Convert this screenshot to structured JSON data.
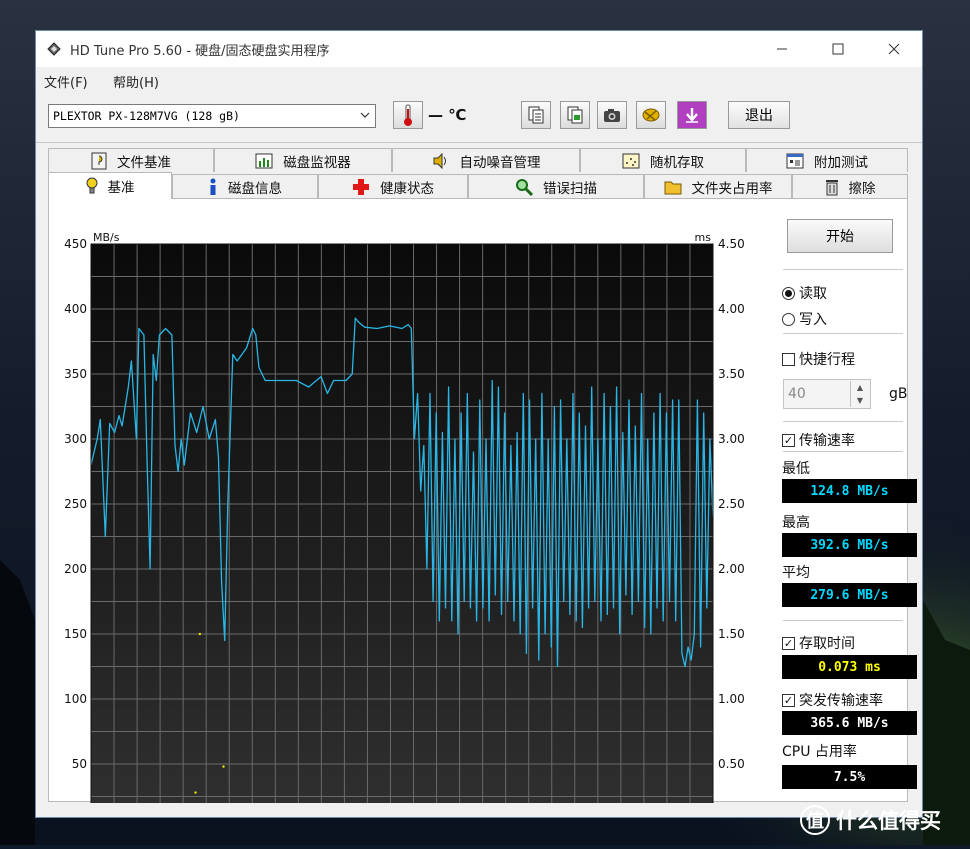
{
  "window": {
    "title": "HD Tune Pro 5.60 - 硬盘/固态硬盘实用程序",
    "controls": [
      "minimize",
      "maximize",
      "close"
    ]
  },
  "menu": {
    "items": [
      "文件(F)",
      "帮助(H)"
    ]
  },
  "toolbar": {
    "drive": "PLEXTOR PX-128M7VG (128 gB)",
    "temperature": "— ℃",
    "exit_label": "退出",
    "icons": [
      "thermometer-icon",
      "copy-text-icon",
      "copy-image-icon",
      "camera-icon",
      "options-icon",
      "download-icon"
    ]
  },
  "tabs": {
    "row1": [
      {
        "label": "文件基准",
        "icon": "file-benchmark-icon"
      },
      {
        "label": "磁盘监视器",
        "icon": "disk-monitor-icon"
      },
      {
        "label": "自动噪音管理",
        "icon": "speaker-icon"
      },
      {
        "label": "随机存取",
        "icon": "random-access-icon"
      },
      {
        "label": "附加测试",
        "icon": "extra-tests-icon"
      }
    ],
    "row2": [
      {
        "label": "基准",
        "icon": "bulb-icon",
        "active": true
      },
      {
        "label": "磁盘信息",
        "icon": "info-icon"
      },
      {
        "label": "健康状态",
        "icon": "health-cross-icon"
      },
      {
        "label": "错误扫描",
        "icon": "magnifier-icon"
      },
      {
        "label": "文件夹占用率",
        "icon": "folder-icon"
      },
      {
        "label": "擦除",
        "icon": "trash-icon"
      }
    ]
  },
  "controls": {
    "start_label": "开始",
    "read_label": "读取",
    "write_label": "写入",
    "mode": "read",
    "short_stroke_label": "快捷行程",
    "short_stroke_checked": false,
    "short_stroke_value": "40",
    "short_stroke_unit": "gB",
    "transfer_rate_label": "传输速率",
    "transfer_rate_checked": true,
    "access_time_label": "存取时间",
    "access_time_checked": true,
    "burst_rate_label": "突发传输速率",
    "burst_rate_checked": true,
    "cpu_label": "CPU 占用率"
  },
  "results": {
    "min_label": "最低",
    "min_value": "124.8 MB/s",
    "max_label": "最高",
    "max_value": "392.6 MB/s",
    "avg_label": "平均",
    "avg_value": "279.6 MB/s",
    "access_time_value": "0.073 ms",
    "burst_value": "365.6 MB/s",
    "cpu_value": "7.5%"
  },
  "colors": {
    "transfer_line": "#29b6e6",
    "access_dots": "#e6e600",
    "plot_bg": "#1c1c1c"
  },
  "chart_data": {
    "type": "line",
    "ylabel_left": "MB/s",
    "ylabel_right": "ms",
    "ylim": [
      0,
      450
    ],
    "ylim_right": [
      0,
      4.5
    ],
    "left_ticks": [
      "450",
      "400",
      "350",
      "300",
      "250",
      "200",
      "150",
      "100",
      "50"
    ],
    "right_ticks": [
      "4.50",
      "4.00",
      "3.50",
      "3.00",
      "2.50",
      "2.00",
      "1.50",
      "1.00",
      "0.50"
    ],
    "x_range": [
      0,
      100
    ],
    "grid": true,
    "series": [
      {
        "points": [
          [
            0,
            280
          ],
          [
            1,
            300
          ],
          [
            1.5,
            315
          ],
          [
            2.3,
            225
          ],
          [
            3,
            312
          ],
          [
            3.8,
            305
          ],
          [
            4.5,
            318
          ],
          [
            5,
            310
          ],
          [
            6,
            340
          ],
          [
            6.5,
            360
          ],
          [
            7.3,
            300
          ],
          [
            7.7,
            385
          ],
          [
            8.5,
            380
          ],
          [
            9,
            285
          ],
          [
            9.5,
            200
          ],
          [
            10,
            365
          ],
          [
            10.5,
            345
          ],
          [
            11,
            380
          ],
          [
            12,
            385
          ],
          [
            13,
            380
          ],
          [
            13.5,
            295
          ],
          [
            14,
            275
          ],
          [
            14.5,
            300
          ],
          [
            15,
            280
          ],
          [
            16,
            320
          ],
          [
            17,
            305
          ],
          [
            18,
            325
          ],
          [
            19,
            300
          ],
          [
            20,
            315
          ],
          [
            20.5,
            285
          ],
          [
            21,
            190
          ],
          [
            21.5,
            145
          ],
          [
            22,
            250
          ],
          [
            22.8,
            365
          ],
          [
            23.5,
            360
          ],
          [
            25,
            370
          ],
          [
            26,
            385
          ],
          [
            26.5,
            380
          ],
          [
            27,
            355
          ],
          [
            28,
            345
          ],
          [
            29,
            345
          ],
          [
            31,
            345
          ],
          [
            33,
            345
          ],
          [
            35,
            340
          ],
          [
            37,
            348
          ],
          [
            38,
            335
          ],
          [
            39,
            345
          ],
          [
            40,
            345
          ],
          [
            41,
            345
          ],
          [
            42,
            350
          ],
          [
            42.5,
            393
          ],
          [
            43,
            390
          ],
          [
            44,
            386
          ],
          [
            46,
            385
          ],
          [
            48,
            387
          ],
          [
            50,
            385
          ],
          [
            51,
            388
          ],
          [
            51.5,
            385
          ],
          [
            52,
            300
          ],
          [
            52.5,
            335
          ],
          [
            53,
            260
          ],
          [
            53.5,
            295
          ],
          [
            54,
            200
          ],
          [
            54.5,
            335
          ],
          [
            55,
            175
          ],
          [
            55.5,
            320
          ],
          [
            56,
            160
          ],
          [
            56.5,
            305
          ],
          [
            57,
            170
          ],
          [
            57.5,
            340
          ],
          [
            58,
            160
          ],
          [
            58.5,
            300
          ],
          [
            59,
            150
          ],
          [
            59.5,
            320
          ],
          [
            60,
            175
          ],
          [
            60.5,
            335
          ],
          [
            61,
            170
          ],
          [
            61.5,
            290
          ],
          [
            62,
            160
          ],
          [
            62.5,
            330
          ],
          [
            63,
            170
          ],
          [
            63.5,
            300
          ],
          [
            64,
            160
          ],
          [
            64.5,
            345
          ],
          [
            65,
            180
          ],
          [
            65.5,
            340
          ],
          [
            66,
            165
          ],
          [
            66.5,
            320
          ],
          [
            67,
            175
          ],
          [
            67.5,
            295
          ],
          [
            68,
            160
          ],
          [
            68.5,
            305
          ],
          [
            69,
            150
          ],
          [
            69.5,
            335
          ],
          [
            70,
            135
          ],
          [
            70.5,
            330
          ],
          [
            71,
            170
          ],
          [
            71.5,
            300
          ],
          [
            72,
            130
          ],
          [
            72.5,
            335
          ],
          [
            73,
            150
          ],
          [
            73.5,
            300
          ],
          [
            74,
            140
          ],
          [
            74.5,
            325
          ],
          [
            75,
            125
          ],
          [
            75.5,
            330
          ],
          [
            76,
            175
          ],
          [
            76.5,
            300
          ],
          [
            77,
            165
          ],
          [
            77.5,
            335
          ],
          [
            78,
            160
          ],
          [
            78.5,
            320
          ],
          [
            79,
            155
          ],
          [
            79.5,
            310
          ],
          [
            80,
            170
          ],
          [
            80.5,
            340
          ],
          [
            81,
            175
          ],
          [
            81.5,
            300
          ],
          [
            82,
            160
          ],
          [
            82.5,
            335
          ],
          [
            83,
            165
          ],
          [
            83.5,
            325
          ],
          [
            84,
            170
          ],
          [
            84.5,
            340
          ],
          [
            85,
            150
          ],
          [
            85.5,
            305
          ],
          [
            86,
            180
          ],
          [
            86.5,
            330
          ],
          [
            87,
            165
          ],
          [
            87.5,
            310
          ],
          [
            88,
            175
          ],
          [
            88.5,
            335
          ],
          [
            89,
            155
          ],
          [
            89.5,
            300
          ],
          [
            90,
            150
          ],
          [
            90.5,
            320
          ],
          [
            91,
            170
          ],
          [
            91.5,
            335
          ],
          [
            92,
            160
          ],
          [
            92.5,
            320
          ],
          [
            93,
            175
          ],
          [
            93.5,
            330
          ],
          [
            94,
            160
          ],
          [
            94.5,
            330
          ],
          [
            95,
            135
          ],
          [
            95.5,
            125
          ],
          [
            96,
            140
          ],
          [
            96.5,
            130
          ],
          [
            97,
            150
          ],
          [
            97.5,
            330
          ],
          [
            98,
            140
          ],
          [
            98.5,
            320
          ],
          [
            99,
            170
          ],
          [
            99.5,
            300
          ],
          [
            100,
            240
          ]
        ]
      },
      {
        "type": "scatter",
        "points": [
          [
            17.5,
            1.5
          ],
          [
            21.3,
            0.48
          ],
          [
            16.8,
            0.28
          ]
        ]
      }
    ]
  }
}
